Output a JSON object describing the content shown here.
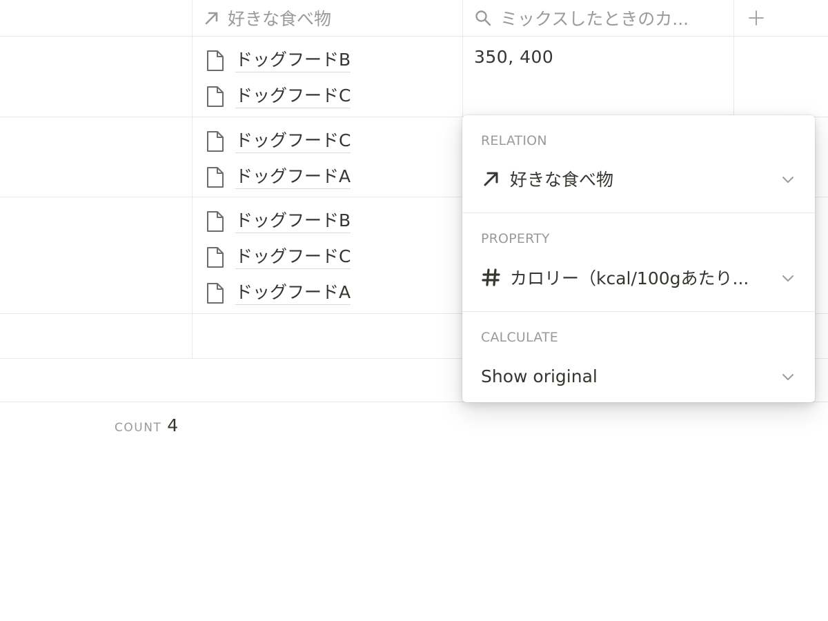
{
  "header": {
    "relation_column": {
      "icon": "arrow-up-right-icon",
      "label": "好きな食べ物"
    },
    "rollup_column": {
      "icon": "search-icon",
      "label": "ミックスしたときのカ..."
    },
    "add_column": {
      "icon": "plus-icon"
    }
  },
  "rows": [
    {
      "links": [
        "ドッグフードB",
        "ドッグフードC"
      ],
      "rollup": "350, 400"
    },
    {
      "links": [
        "ドッグフードC",
        "ドッグフードA"
      ],
      "rollup": ""
    },
    {
      "links": [
        "ドッグフードB",
        "ドッグフードC",
        "ドッグフードA"
      ],
      "rollup": ""
    },
    {
      "links": [],
      "rollup": ""
    }
  ],
  "footer": {
    "count_label": "COUNT",
    "count_value": "4"
  },
  "popover": {
    "relation": {
      "label": "RELATION",
      "icon": "arrow-up-right-icon",
      "value": "好きな食べ物"
    },
    "property": {
      "label": "PROPERTY",
      "icon": "hash-icon",
      "value": "カロリー（kcal/100gあたり..."
    },
    "calculate": {
      "label": "CALCULATE",
      "value": "Show original"
    }
  },
  "colors": {
    "text": "#37352f",
    "muted": "#9b9a97",
    "grid": "#e9e9e7"
  }
}
